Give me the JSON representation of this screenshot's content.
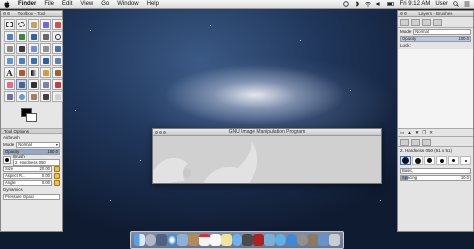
{
  "menubar": {
    "app_name": "Finder",
    "items": [
      "File",
      "Edit",
      "View",
      "Go",
      "Window",
      "Help"
    ],
    "clock": "Fri 9:12 AM",
    "user": "User"
  },
  "toolbox": {
    "title": "Toolbox - Tool",
    "tool_options_title": "Tool Options",
    "tool_name": "Airbrush",
    "mode_label": "Mode",
    "mode_value": "Normal",
    "opacity_label": "Opacity",
    "opacity_value": "100.0",
    "brush_label": "Brush",
    "brush_value": "2. Hardness 050",
    "size_label": "Size",
    "size_value": "20.00",
    "aspect_label": "Aspect R...",
    "aspect_value": "0.00",
    "angle_label": "Angle",
    "angle_value": "0.00",
    "dynamics_label": "Dynamics",
    "dynamics_value": "Pressure Opaci"
  },
  "rdock": {
    "title": "Layers - Brushes",
    "mode_label": "Mode",
    "mode_value": "Normal",
    "opacity_label": "Opacity",
    "opacity_value": "100.0",
    "lock_label": "Lock:",
    "brush_name": "2. Hardness 050 (51 x 51)",
    "preset_value": "Basic,",
    "spacing_label": "Spacing",
    "spacing_value": "10.0"
  },
  "gimp_window": {
    "title": "GNU Image Manipulation Program"
  }
}
